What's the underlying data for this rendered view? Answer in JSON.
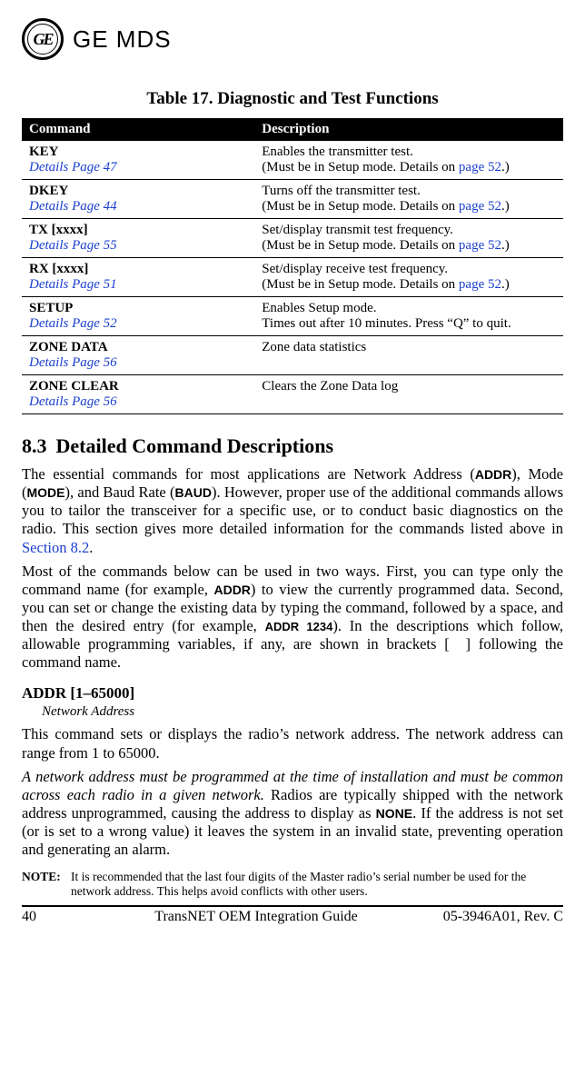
{
  "brand": {
    "logo_text": "GE",
    "name": "GE MDS"
  },
  "table": {
    "title": "Table 17. Diagnostic and Test Functions",
    "headers": [
      "Command",
      "Description"
    ],
    "rows": [
      {
        "cmd": "KEY",
        "details_prefix": "Details ",
        "details_page": "Page 47",
        "desc1": "Enables the transmitter test.",
        "desc2_a": "(Must be in Setup mode. Details on ",
        "desc2_link": "page 52",
        "desc2_b": ".)"
      },
      {
        "cmd": "DKEY",
        "details_prefix": "Details ",
        "details_page": "Page 44",
        "desc1": "Turns off the transmitter test.",
        "desc2_a": "(Must be in Setup mode. Details on ",
        "desc2_link": "page 52",
        "desc2_b": ".)"
      },
      {
        "cmd": "TX [xxxx]",
        "details_prefix": "Details ",
        "details_page": "Page 55",
        "desc1": "Set/display transmit test frequency.",
        "desc2_a": "(Must be in Setup mode. Details on ",
        "desc2_link": "page 52",
        "desc2_b": ".)"
      },
      {
        "cmd": "RX [xxxx]",
        "details_prefix": "Details ",
        "details_page": "Page 51",
        "desc1": "Set/display receive test frequency.",
        "desc2_a": "(Must be in Setup mode. Details on ",
        "desc2_link": "page 52",
        "desc2_b": ".)"
      },
      {
        "cmd": "SETUP",
        "details_prefix": "Details ",
        "details_page": "Page 52",
        "desc1": "Enables Setup mode.",
        "desc2_a": "Times out after 10 minutes. Press “Q” to quit.",
        "desc2_link": "",
        "desc2_b": ""
      },
      {
        "cmd": "ZONE DATA",
        "details_prefix": "Details ",
        "details_page": "Page 56",
        "desc1": "Zone data statistics",
        "desc2_a": "",
        "desc2_link": "",
        "desc2_b": ""
      },
      {
        "cmd": "ZONE CLEAR",
        "details_prefix": "Details ",
        "details_page": "Page 56",
        "desc1": "Clears the Zone Data log",
        "desc2_a": "",
        "desc2_link": "",
        "desc2_b": ""
      }
    ]
  },
  "section": {
    "num": "8.3",
    "title": "Detailed Command Descriptions",
    "p1a": "The essential commands for most applications are Network Address (",
    "p1_addr": "ADDR",
    "p1b": "), Mode (",
    "p1_mode": "MODE",
    "p1c": "), and Baud Rate (",
    "p1_baud": "BAUD",
    "p1d": "). However, proper use of the additional commands allows you to tailor the transceiver for a specific use, or to conduct basic diagnostics on the radio. This section gives more detailed information for the commands listed above in ",
    "p1_link": "Section 8.2",
    "p1e": ".",
    "p2a": "Most of the commands below can be used in two ways. First, you can type only the command name (for example, ",
    "p2_addr": "ADDR",
    "p2b": ") to view the currently programmed data. Second, you can set or change the existing data by typing the command, followed by a space, and then the desired entry (for example, ",
    "p2_addr1234": "ADDR 1234",
    "p2c": "). In the descriptions which follow, allowable programming variables, if any, are shown in brackets [  ] following the command name."
  },
  "addr": {
    "head": "ADDR [1–65000]",
    "sub": "Network Address",
    "p1": "This command sets or displays the radio’s network address. The network address can range from 1 to 65000.",
    "p2a": "A network address must be programmed at the time of installation and must be common across each radio in a given network.",
    "p2b": " Radios are typically shipped with the network address unprogrammed, causing the address to display as ",
    "p2_none": "NONE",
    "p2c": ". If the address is not set (or is set to a wrong value) it leaves the system in an invalid state, preventing operation and generating an alarm."
  },
  "note": {
    "label": "NOTE:",
    "text": "It is recommended that the last four digits of the Master radio’s serial number be used for the network address. This helps avoid conflicts with other users."
  },
  "footer": {
    "page": "40",
    "title": "TransNET OEM Integration Guide",
    "rev": "05-3946A01, Rev. C"
  }
}
